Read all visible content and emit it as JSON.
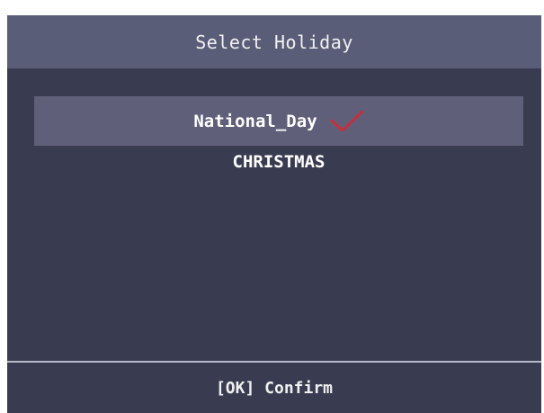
{
  "header": {
    "title": "Select Holiday"
  },
  "holidays": [
    {
      "label": "National_Day",
      "selected": true,
      "icon": "checkmark-icon"
    },
    {
      "label": "CHRISTMAS",
      "selected": false
    }
  ],
  "footer": {
    "hint": "[OK] Confirm"
  },
  "colors": {
    "background": "#393c50",
    "header": "#5a5d77",
    "selected_row": "#605f79",
    "check": "#e0242c"
  }
}
